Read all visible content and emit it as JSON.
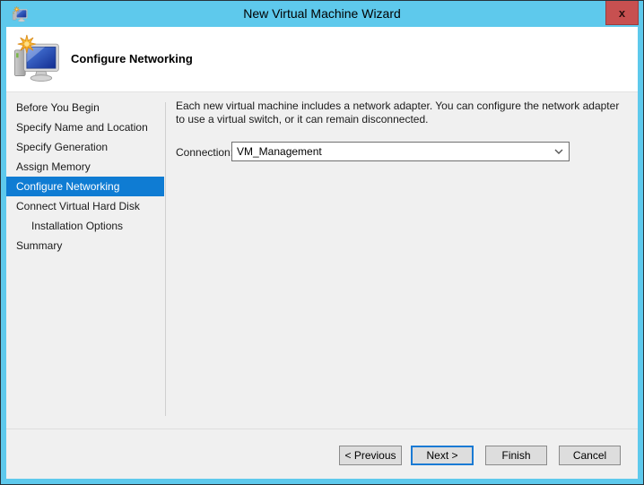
{
  "window": {
    "title": "New Virtual Machine Wizard",
    "close_label": "x"
  },
  "header": {
    "page_title": "Configure Networking"
  },
  "sidebar": {
    "items": [
      {
        "label": "Before You Begin",
        "active": false,
        "indent": false
      },
      {
        "label": "Specify Name and Location",
        "active": false,
        "indent": false
      },
      {
        "label": "Specify Generation",
        "active": false,
        "indent": false
      },
      {
        "label": "Assign Memory",
        "active": false,
        "indent": false
      },
      {
        "label": "Configure Networking",
        "active": true,
        "indent": false
      },
      {
        "label": "Connect Virtual Hard Disk",
        "active": false,
        "indent": false
      },
      {
        "label": "Installation Options",
        "active": false,
        "indent": true
      },
      {
        "label": "Summary",
        "active": false,
        "indent": false
      }
    ]
  },
  "content": {
    "description": "Each new virtual machine includes a network adapter. You can configure the network adapter to use a virtual switch, or it can remain disconnected.",
    "connection_label": "Connection:",
    "connection_value": "VM_Management"
  },
  "footer": {
    "buttons": [
      {
        "label": "< Previous",
        "default": false
      },
      {
        "label": "Next >",
        "default": true
      },
      {
        "label": "Finish",
        "default": false
      },
      {
        "label": "Cancel",
        "default": false
      }
    ]
  },
  "colors": {
    "titlebar": "#5ec9ec",
    "frame_border": "#27343c",
    "close_button": "#c75050",
    "selection": "#0f7cd3",
    "default_button_border": "#1a7ad4",
    "body_background": "#f0f0f0",
    "header_background": "#ffffff"
  }
}
